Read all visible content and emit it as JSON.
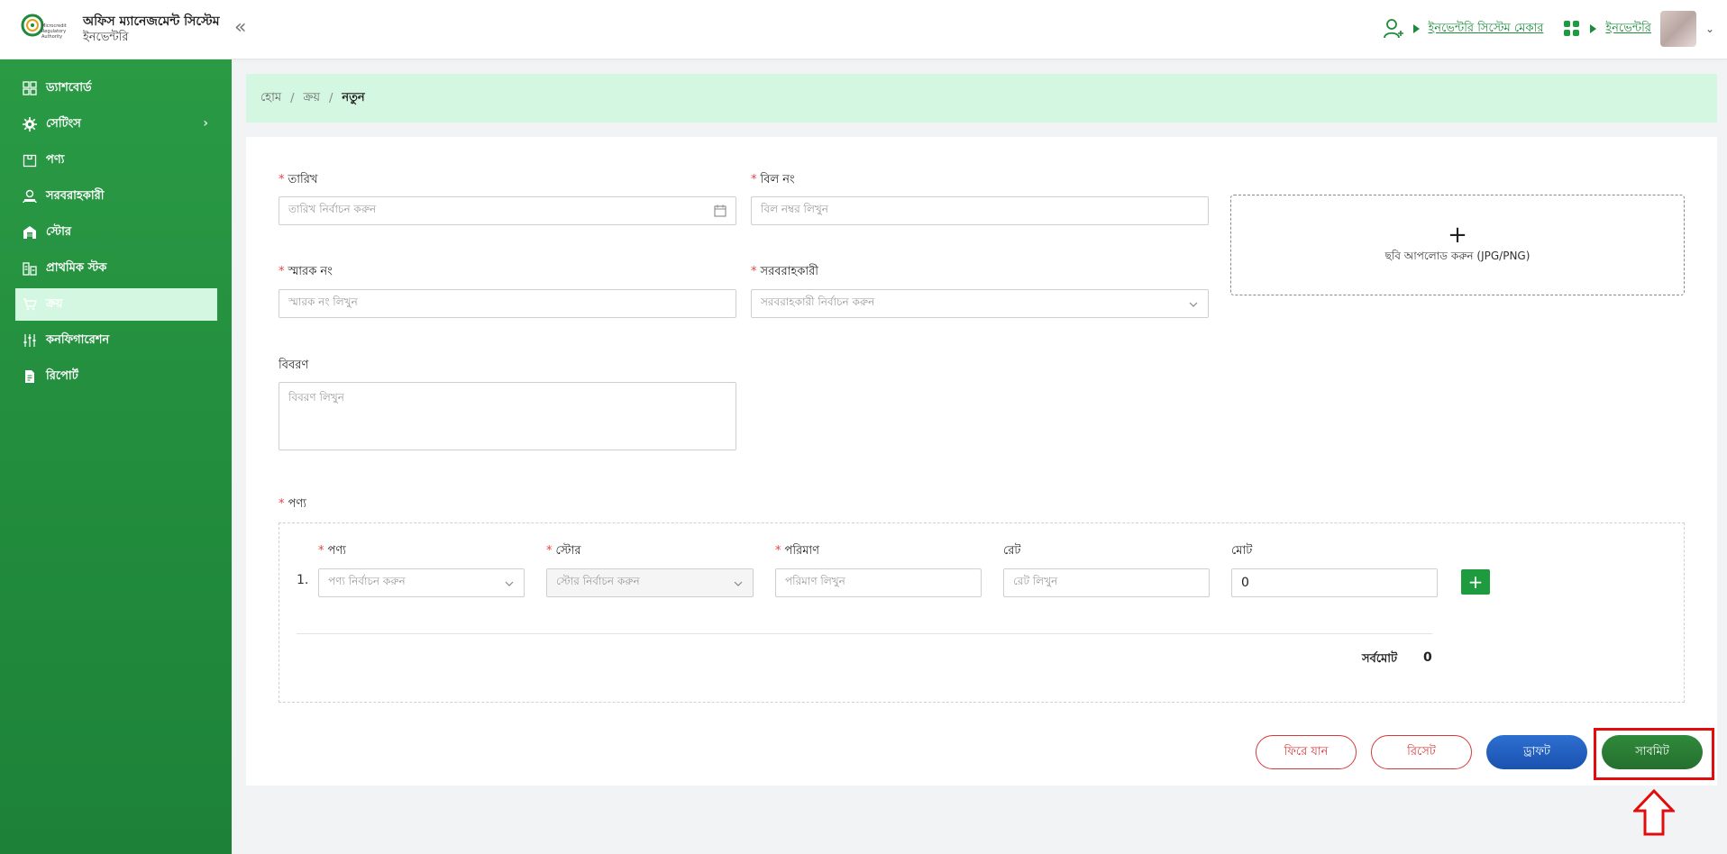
{
  "header": {
    "title": "অফিস ম্যানেজমেন্ট সিস্টেম",
    "subtitle": "ইনভেন্টরি",
    "logo_text": "Microcredit Regulatory Authority",
    "collapse": "«",
    "links": [
      "ইনভেন্টরি সিস্টেম মেকার",
      "ইনভেন্টরি"
    ],
    "colors": {
      "accent": "#1e8a3c",
      "sidebar": "#22903d",
      "breadcrumb": "#d3f7e0"
    }
  },
  "sidebar": {
    "items": [
      {
        "label": "ড্যাশবোর্ড",
        "icon": "dashboard-icon"
      },
      {
        "label": "সেটিংস",
        "icon": "gear-icon"
      },
      {
        "label": "পণ্য",
        "icon": "box-icon"
      },
      {
        "label": "সরবরাহকারী",
        "icon": "supplier-icon"
      },
      {
        "label": "স্টোর",
        "icon": "store-icon"
      },
      {
        "label": "প্রাথমিক স্টক",
        "icon": "stock-icon"
      },
      {
        "label": "ক্রয়",
        "icon": "cart-icon"
      },
      {
        "label": "কনফিগারেশন",
        "icon": "sliders-icon"
      },
      {
        "label": "রিপোর্ট",
        "icon": "report-icon"
      }
    ],
    "active_index": 6
  },
  "breadcrumb": {
    "home": "হোম",
    "section": "ক্রয়",
    "current": "নতুন"
  },
  "form": {
    "date": {
      "label": "তারিখ",
      "placeholder": "তারিখ নির্বাচন করুন"
    },
    "bill": {
      "label": "বিল নং",
      "placeholder": "বিল নম্বর লিখুন"
    },
    "memo": {
      "label": "স্মারক নং",
      "placeholder": "স্মারক নং লিখুন"
    },
    "supplier": {
      "label": "সরবরাহকারী",
      "placeholder": "সরবরাহকারী নির্বাচন করুন"
    },
    "description": {
      "label": "বিবরণ",
      "placeholder": "বিবরণ লিখুন"
    },
    "upload": {
      "plus": "+",
      "text": "ছবি আপলোড করুন (JPG/PNG)"
    },
    "products_label": "পণ্য",
    "products": {
      "columns": [
        "পণ্য",
        "স্টোর",
        "পরিমাণ",
        "রেট",
        "মোট"
      ],
      "rows": [
        {
          "num": "1.",
          "product_placeholder": "পণ্য নির্বাচন করুন",
          "store_placeholder": "স্টোর নির্বাচন করুন",
          "qty_placeholder": "পরিমাণ লিখুন",
          "rate_placeholder": "রেট লিখুন",
          "total": "0"
        }
      ],
      "grand_total_label": "সর্বমোট",
      "grand_total": "0"
    }
  },
  "actions": {
    "back": "ফিরে যান",
    "reset": "রিসেট",
    "draft": "ড্রাফট",
    "submit": "সাবমিট"
  }
}
